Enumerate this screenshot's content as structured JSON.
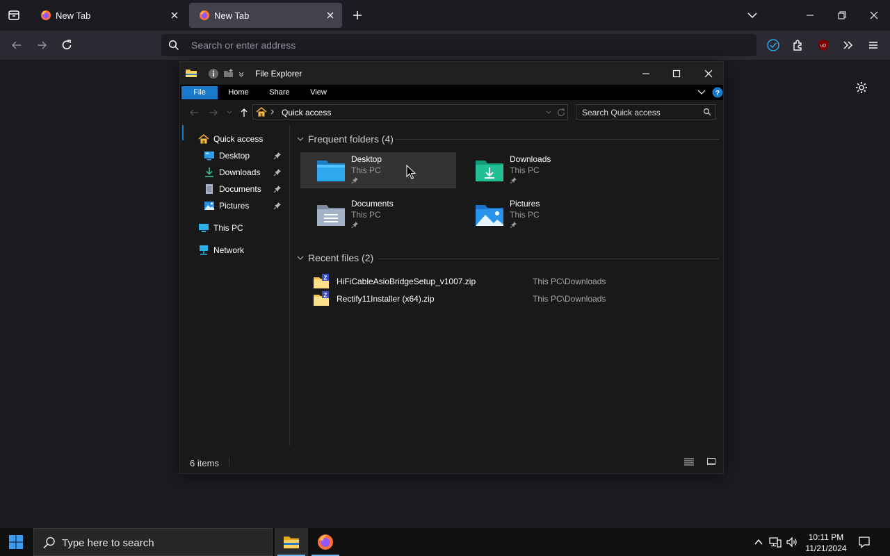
{
  "browser": {
    "tabs": [
      {
        "label": "New Tab",
        "active": false
      },
      {
        "label": "New Tab",
        "active": true
      }
    ],
    "address_placeholder": "Search or enter address"
  },
  "explorer": {
    "title": "File Explorer",
    "ribbon_tabs": [
      "File",
      "Home",
      "Share",
      "View"
    ],
    "breadcrumb": "Quick access",
    "search_placeholder": "Search Quick access",
    "nav": {
      "quick_access": "Quick access",
      "pinned": [
        {
          "label": "Desktop",
          "icon": "desktop-icon"
        },
        {
          "label": "Downloads",
          "icon": "downloads-icon"
        },
        {
          "label": "Documents",
          "icon": "documents-icon"
        },
        {
          "label": "Pictures",
          "icon": "pictures-icon"
        }
      ],
      "this_pc": "This PC",
      "network": "Network"
    },
    "frequent_header": "Frequent folders (4)",
    "frequent": [
      {
        "name": "Desktop",
        "location": "This PC"
      },
      {
        "name": "Downloads",
        "location": "This PC"
      },
      {
        "name": "Documents",
        "location": "This PC"
      },
      {
        "name": "Pictures",
        "location": "This PC"
      }
    ],
    "recent_header": "Recent files (2)",
    "recent": [
      {
        "name": "HiFiCableAsioBridgeSetup_v1007.zip",
        "location": "This PC\\Downloads"
      },
      {
        "name": "Rectify11Installer (x64).zip",
        "location": "This PC\\Downloads"
      }
    ],
    "status": "6 items"
  },
  "taskbar": {
    "search_placeholder": "Type here to search",
    "time": "10:11 PM",
    "date": "11/21/2024"
  },
  "colors": {
    "accent": "#1979ca",
    "browser_bg": "#1c1b22",
    "toolbar_bg": "#2b2a33"
  }
}
